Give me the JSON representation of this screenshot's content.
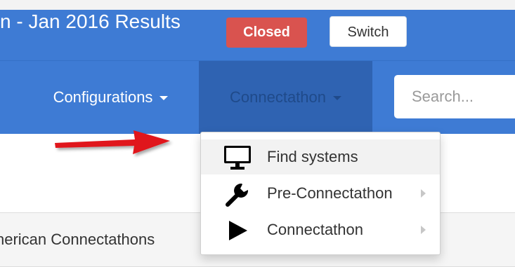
{
  "header": {
    "title": "n - Jan 2016 Results",
    "status_badge": "Closed",
    "switch_label": "Switch"
  },
  "nav": {
    "items": [
      {
        "label": "Configurations",
        "active": false
      },
      {
        "label": "Connectathon",
        "active": true
      }
    ],
    "search": {
      "placeholder": "Search..."
    }
  },
  "dropdown": {
    "items": [
      {
        "label": "Find systems",
        "icon": "monitor-icon",
        "has_submenu": false,
        "highlighted": true
      },
      {
        "label": "Pre-Connectathon",
        "icon": "wrench-icon",
        "has_submenu": true,
        "highlighted": false
      },
      {
        "label": "Connectathon",
        "icon": "play-icon",
        "has_submenu": true,
        "highlighted": false
      }
    ]
  },
  "panel": {
    "text": "nerican Connectathons"
  },
  "annotation": {
    "icon": "red-arrow-icon"
  },
  "colors": {
    "primary": "#3e7bd4",
    "active_nav": "#2f63b2",
    "danger": "#d9534f",
    "arrow": "#e0141b"
  }
}
